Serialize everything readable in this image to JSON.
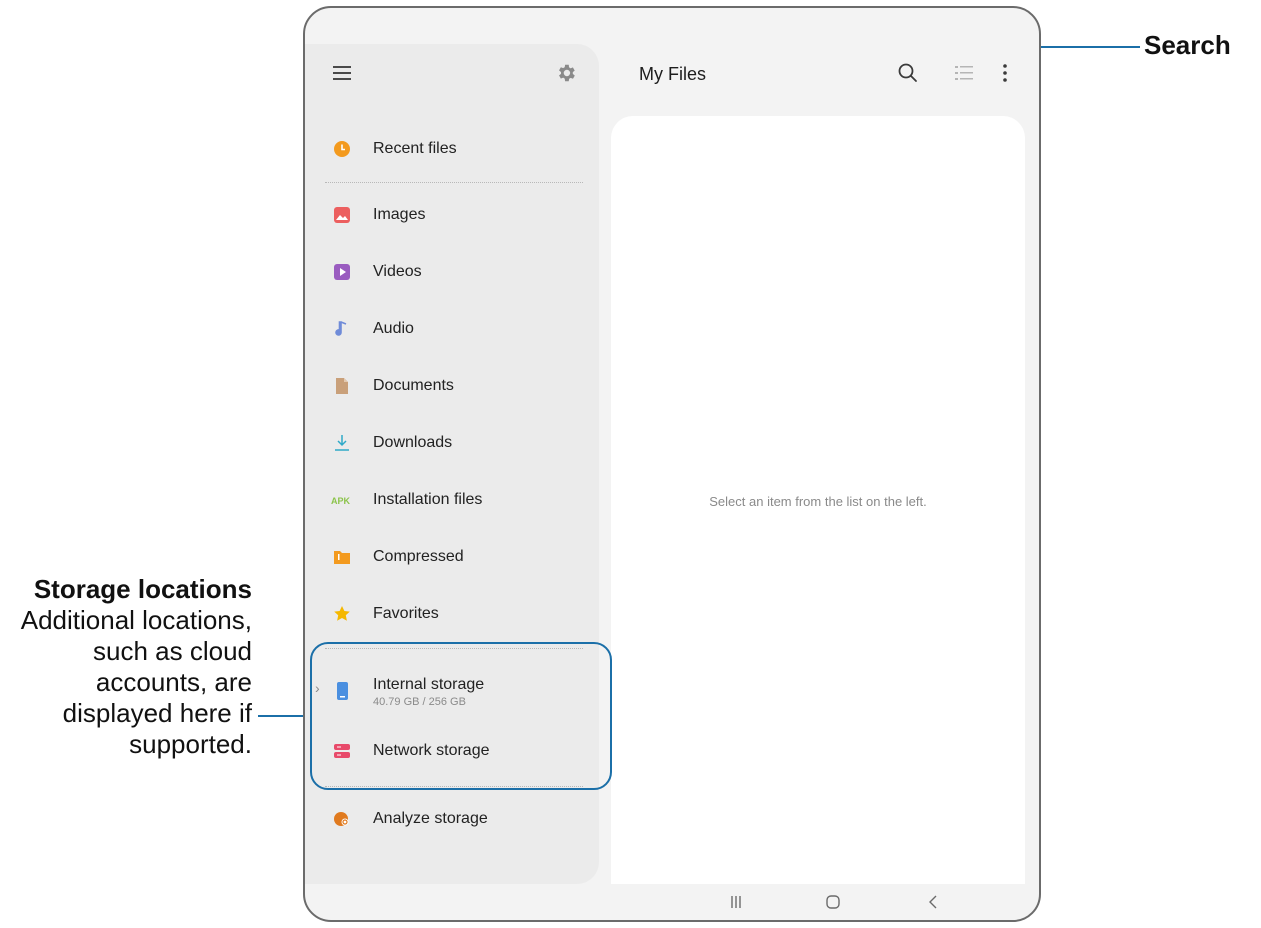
{
  "app": {
    "title": "My Files",
    "toolbar": {
      "search_icon": "search-icon",
      "list_view_icon": "list-view-icon",
      "more_icon": "more-options-icon"
    },
    "drawer": {
      "menu_icon": "hamburger-menu-icon",
      "settings_icon": "gear-icon"
    }
  },
  "categories": [
    {
      "label": "Recent files",
      "icon": "clock-icon",
      "color": "#f39a1e"
    },
    {
      "label": "Images",
      "icon": "image-icon",
      "color": "#ec5f5f"
    },
    {
      "label": "Videos",
      "icon": "video-icon",
      "color": "#9a5cc0"
    },
    {
      "label": "Audio",
      "icon": "music-note-icon",
      "color": "#6f8bd8"
    },
    {
      "label": "Documents",
      "icon": "document-icon",
      "color": "#c9a07a"
    },
    {
      "label": "Downloads",
      "icon": "download-icon",
      "color": "#2fa9c8"
    },
    {
      "label": "Installation files",
      "icon": "apk-icon",
      "color": "#8bc34a"
    },
    {
      "label": "Compressed",
      "icon": "zip-folder-icon",
      "color": "#f39a1e"
    },
    {
      "label": "Favorites",
      "icon": "star-icon",
      "color": "#f5b800"
    }
  ],
  "storage": [
    {
      "label": "Internal storage",
      "sub": "40.79 GB / 256 GB",
      "icon": "phone-storage-icon",
      "color": "#4a8fe0"
    },
    {
      "label": "Network storage",
      "icon": "network-storage-icon",
      "color": "#e84a6a"
    }
  ],
  "analyze": {
    "label": "Analyze storage",
    "icon": "analyze-storage-icon",
    "color": "#e07a1e"
  },
  "main": {
    "empty_message": "Select an item from the list on the left."
  },
  "system_nav": {
    "recents_icon": "recents-icon",
    "home_icon": "home-icon",
    "back_icon": "back-icon"
  },
  "callouts": {
    "search": "Search",
    "storage_title": "Storage locations",
    "storage_desc": "Additional locations, such as cloud accounts, are displayed here if supported.",
    "accent_color": "#1b6fa8"
  }
}
